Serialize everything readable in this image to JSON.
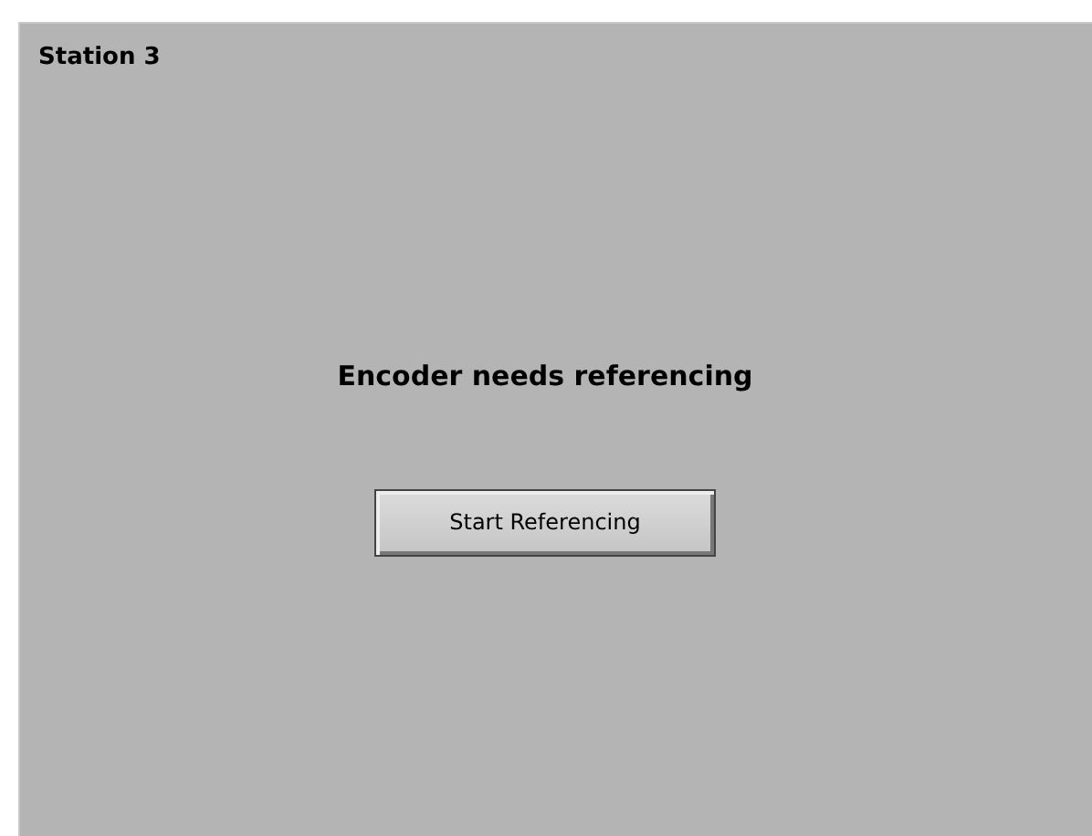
{
  "panel": {
    "title": "Station 3"
  },
  "message": "Encoder needs referencing",
  "button": {
    "label": "Start Referencing"
  }
}
